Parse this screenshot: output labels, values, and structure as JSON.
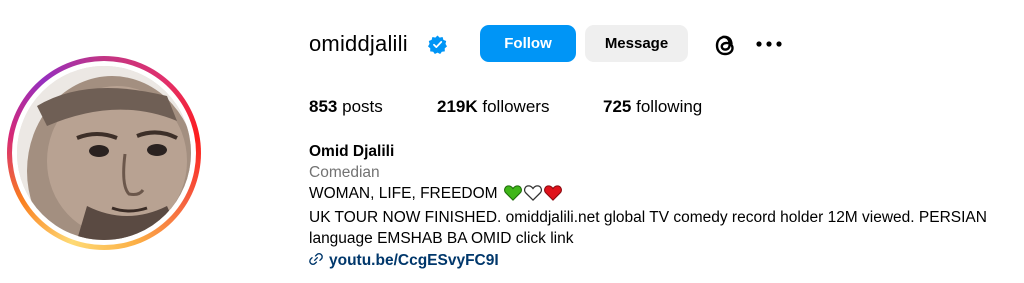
{
  "profile": {
    "username": "omiddjalili",
    "verified": true,
    "follow_label": "Follow",
    "message_label": "Message",
    "icons": {
      "verified": "verified-badge-icon",
      "threads": "threads-icon",
      "more": "more-options-icon",
      "link": "link-icon"
    },
    "colors": {
      "follow_button": "#0095f6",
      "message_button": "#efefef",
      "verified_badge": "#0095f6",
      "link_text": "#00376b"
    }
  },
  "stats": {
    "posts_count": "853",
    "posts_label": "posts",
    "followers_count": "219K",
    "followers_label": "followers",
    "following_count": "725",
    "following_label": "following"
  },
  "bio": {
    "name": "Omid Djalili",
    "category": "Comedian",
    "line1": "WOMAN, LIFE, FREEDOM",
    "hearts": [
      "green-heart",
      "white-heart",
      "red-heart"
    ],
    "description": "UK TOUR NOW FINISHED. omiddjalili.net global TV comedy record holder 12M viewed. PERSIAN language EMSHAB BA OMID click link",
    "link": "youtu.be/CcgESvyFC9I"
  }
}
